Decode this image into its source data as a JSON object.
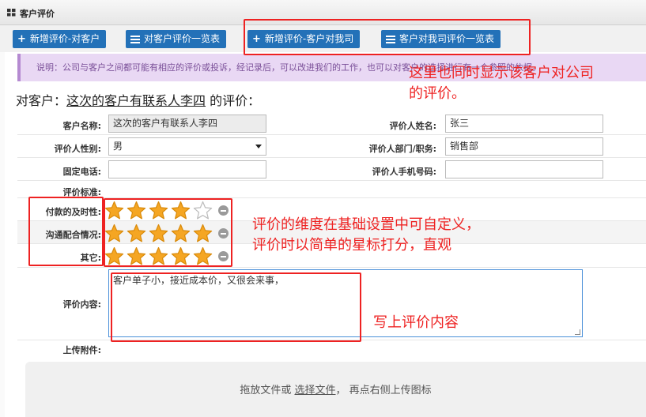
{
  "window": {
    "title": "客户评价"
  },
  "toolbar": {
    "add_eval_customer": "新增评价-对客户",
    "eval_customer_list": "对客户评价一览表",
    "add_eval_of_us": "新增评价-客户对我司",
    "eval_of_us_list": "客户对我司评价一览表"
  },
  "notice": {
    "text": "说明：公司与客户之间都可能有相应的评价或投诉，经记录后，可以改进我们的工作，也可以对客户的选择进行有一个参照的依据。"
  },
  "heading": {
    "prefix": "对客户：",
    "customer": "这次的客户有联系人李四",
    "suffix": " 的评价："
  },
  "form": {
    "customer_name_label": "客户名称:",
    "customer_name_value": "这次的客户有联系人李四",
    "evaluator_name_label": "评价人姓名:",
    "evaluator_name_value": "张三",
    "gender_label": "评价人性别:",
    "gender_value": "男",
    "dept_label": "评价人部门/职务:",
    "dept_value": "销售部",
    "phone_label": "固定电话:",
    "phone_value": "",
    "mobile_label": "评价人手机号码:",
    "mobile_value": "",
    "criteria_label": "评价标准:",
    "content_label": "评价内容:",
    "content_value": "客户单子小，接近成本价，又很会来事，",
    "attachment_label": "上传附件:"
  },
  "ratings": [
    {
      "label": "付款的及时性:",
      "score": 4,
      "max": 5
    },
    {
      "label": "沟通配合情况:",
      "score": 5,
      "max": 5
    },
    {
      "label": "其它:",
      "score": 5,
      "max": 5
    }
  ],
  "upload": {
    "before": "拖放文件或 ",
    "link": "选择文件",
    "after": "， 再点右侧上传图标"
  },
  "annotations": {
    "top_right_line1": "这里也同时显示该客户对公司",
    "top_right_line2": "的评价。",
    "stars_line1": "评价的维度在基础设置中可自定义，",
    "stars_line2": "评价时以简单的星标打分，直观",
    "content_note": "写上评价内容"
  },
  "colors": {
    "button_blue": "#2371b8",
    "annotation_red": "#ee2222",
    "star_gold": "#f5a623",
    "notice_bg": "#e9d8f4"
  }
}
